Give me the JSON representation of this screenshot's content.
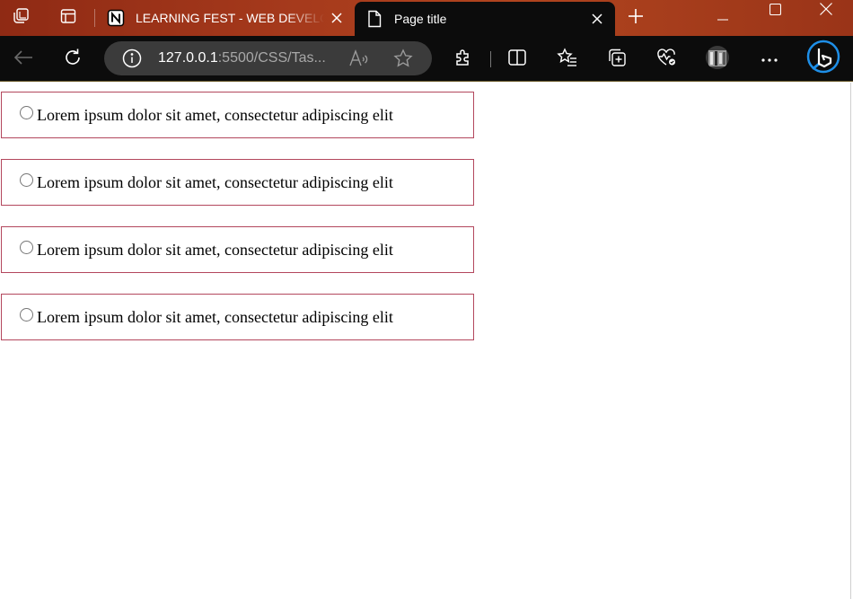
{
  "browser": {
    "tabs": [
      {
        "title": "LEARNING FEST - WEB DEVELOPMENT",
        "favicon": "notion-icon",
        "active": false
      },
      {
        "title": "Page title",
        "favicon": "page-icon",
        "active": true
      }
    ],
    "address": {
      "host": "127.0.0.1",
      "rest": ":5500/CSS/Tas..."
    },
    "colors": {
      "titlebar": "#a63a1c",
      "toolbar": "#0c0c0c",
      "address_bg": "#3b3b3b",
      "option_border": "#b3475d"
    }
  },
  "options": [
    {
      "label": "Lorem ipsum dolor sit amet, consectetur adipiscing elit",
      "checked": false
    },
    {
      "label": "Lorem ipsum dolor sit amet, consectetur adipiscing elit",
      "checked": false
    },
    {
      "label": "Lorem ipsum dolor sit amet, consectetur adipiscing elit",
      "checked": false
    },
    {
      "label": "Lorem ipsum dolor sit amet, consectetur adipiscing elit",
      "checked": false
    }
  ]
}
